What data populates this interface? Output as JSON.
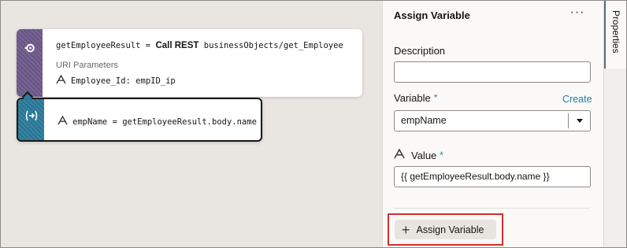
{
  "canvas": {
    "rest_node": {
      "icon": "rest-call-icon",
      "result_var": "getEmployeeResult",
      "equals": "=",
      "call_keyword": "Call REST",
      "endpoint": "businessObjects/get_Employee",
      "uri_params_label": "URI Parameters",
      "param_expr": "Employee_Id: empID_ip",
      "strip_color": "#6f5a8c"
    },
    "assign_node": {
      "icon": "assign-variable-icon",
      "expr": "empName = getEmployeeResult.body.name",
      "strip_color": "#2a7b9b"
    }
  },
  "panel": {
    "title": "Assign Variable",
    "more_label": "···",
    "description_label": "Description",
    "description_value": "",
    "variable_label": "Variable",
    "required_mark": "*",
    "create_label": "Create",
    "variable_value": "empName",
    "value_label": "Value",
    "value_value": "{{ getEmployeeResult.body.name }}",
    "assign_button_label": "Assign Variable",
    "assign_button_plus": "+",
    "highlight_color": "#d0312d",
    "accent_color": "#227fa3"
  },
  "rail": {
    "tab_label": "Properties"
  }
}
